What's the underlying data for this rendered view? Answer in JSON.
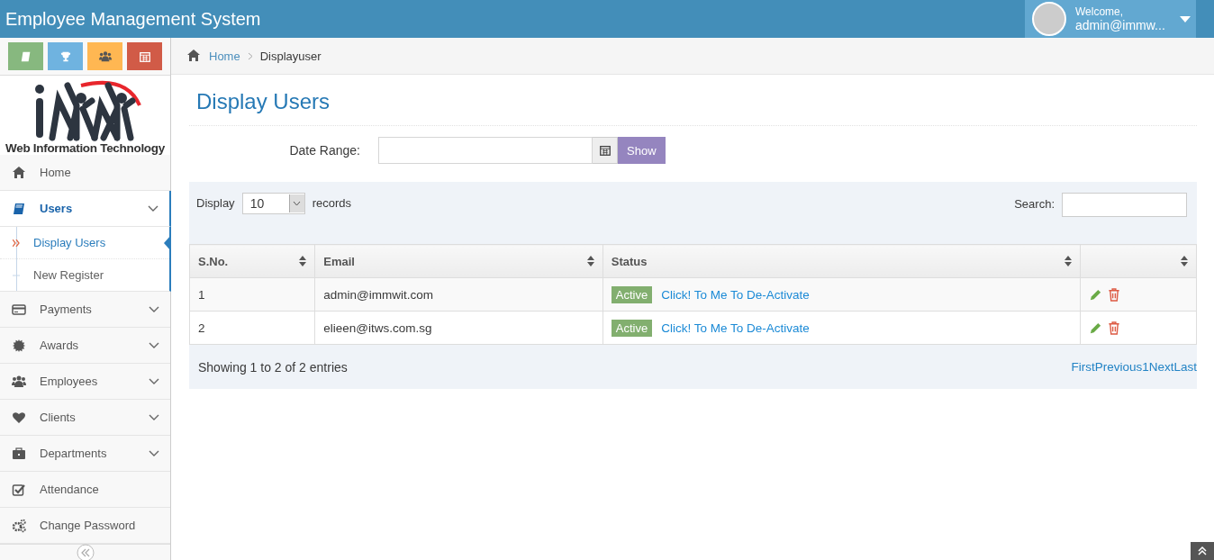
{
  "header": {
    "title": "Employee Management System",
    "user": {
      "greeting": "Welcome,",
      "name": "admin@immw..."
    }
  },
  "sidebar": {
    "shortcuts": [
      {
        "color": "#87b87f"
      },
      {
        "color": "#6fb3e0"
      },
      {
        "color": "#ffb752"
      },
      {
        "color": "#d15b47"
      }
    ],
    "logo_text": "Web Information Technology",
    "items": [
      {
        "label": "Home",
        "selected": false,
        "kind": "link"
      },
      {
        "label": "Users",
        "selected": true,
        "kind": "submenu",
        "expanded": true,
        "children": [
          {
            "label": "Display Users",
            "selected": true
          },
          {
            "label": "New Register",
            "selected": false
          }
        ]
      },
      {
        "label": "Payments",
        "selected": false,
        "kind": "submenu"
      },
      {
        "label": "Awards",
        "selected": false,
        "kind": "submenu"
      },
      {
        "label": "Employees",
        "selected": false,
        "kind": "submenu"
      },
      {
        "label": "Clients",
        "selected": false,
        "kind": "submenu"
      },
      {
        "label": "Departments",
        "selected": false,
        "kind": "submenu"
      },
      {
        "label": "Attendance",
        "selected": false,
        "kind": "link"
      },
      {
        "label": "Change Password",
        "selected": false,
        "kind": "link"
      }
    ]
  },
  "breadcrumb": [
    "Home",
    "Displayuser"
  ],
  "page_title": "Display Users",
  "filter": {
    "label": "Date Range:",
    "button": "Show"
  },
  "table_controls": {
    "display_label": "Display",
    "page_size": "10",
    "records_label": "records",
    "search_label": "Search:"
  },
  "table": {
    "columns": [
      "S.No.",
      "Email",
      "Status",
      ""
    ],
    "rows": [
      {
        "sno": "1",
        "email": "admin@immwit.com",
        "status": "Active",
        "action": "Click! To Me To De-Activate"
      },
      {
        "sno": "2",
        "email": "elieen@itws.com.sg",
        "status": "Active",
        "action": "Click! To Me To De-Activate"
      }
    ]
  },
  "footer": {
    "info": "Showing 1 to 2 of 2 entries",
    "pages": [
      "First",
      "Previous",
      "1",
      "Next",
      "Last"
    ]
  }
}
